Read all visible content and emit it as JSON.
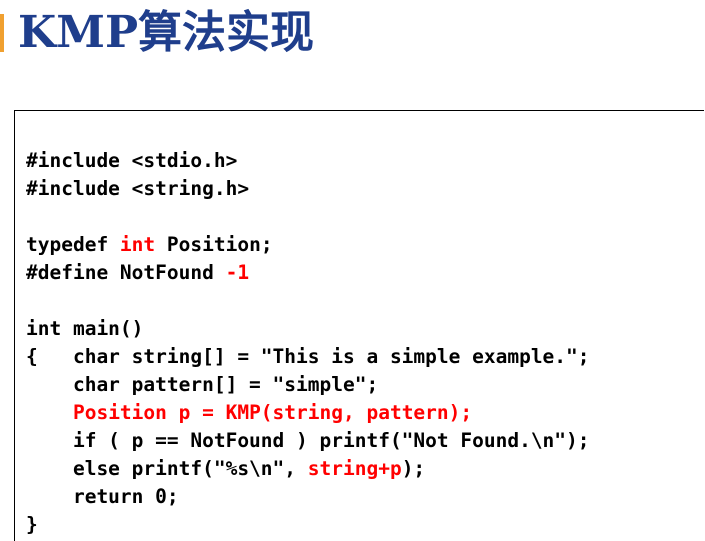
{
  "title": "KMP算法实现",
  "colors": {
    "title": "#1f3e8c",
    "accent": "#f0a030",
    "highlight": "#ff0000"
  },
  "code": {
    "include_stdio": "#include <stdio.h>",
    "include_string": "#include <string.h>",
    "typedef_kw": "typedef ",
    "typedef_type": "int",
    "typedef_rest": " Position;",
    "define_head": "#define NotFound ",
    "define_val": "-1",
    "main_sig": "int main()",
    "decl_string": "{   char string[] = \"This is a simple example.\";",
    "decl_pattern": "    char pattern[] = \"simple\";",
    "indent": "    ",
    "kmp_call": "Position p = KMP(string, pattern);",
    "if_line": "    if ( p == NotFound ) printf(\"Not Found.\\n\");",
    "else_head": "    else printf(\"%s\\n\", ",
    "else_arg": "string+p",
    "else_tail": ");",
    "return_line": "    return 0;",
    "close_brace": "}"
  }
}
